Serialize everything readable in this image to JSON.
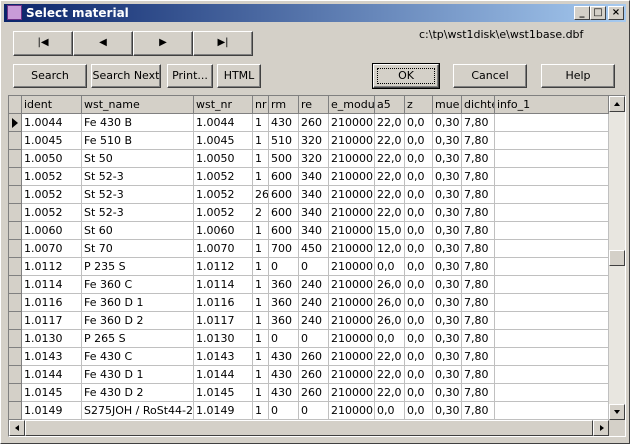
{
  "window": {
    "title": "Select material",
    "minimize": "_",
    "maximize": "□",
    "close": "×"
  },
  "nav": {
    "first": "|◀",
    "prev": "◀",
    "next": "▶",
    "last": "▶|"
  },
  "file_path": "c:\\tp\\wst1disk\\e\\wst1base.dbf",
  "toolbar": {
    "search": "Search",
    "search_next": "Search Next",
    "print": "Print...",
    "html": "HTML",
    "ok": "OK",
    "cancel": "Cancel",
    "help": "Help"
  },
  "table": {
    "columns": [
      "ident",
      "wst_name",
      "wst_nr",
      "nr",
      "rm",
      "re",
      "e_modul",
      "a5",
      "z",
      "mue",
      "dichte",
      "info_1"
    ],
    "rows": [
      [
        "1.0044",
        "Fe 430 B",
        "1.0044",
        "1",
        "430",
        "260",
        "210000",
        "22,0",
        "0,0",
        "0,30",
        "7,80",
        ""
      ],
      [
        "1.0045",
        "Fe 510 B",
        "1.0045",
        "1",
        "510",
        "320",
        "210000",
        "22,0",
        "0,0",
        "0,30",
        "7,80",
        ""
      ],
      [
        "1.0050",
        "St 50",
        "1.0050",
        "1",
        "500",
        "320",
        "210000",
        "22,0",
        "0,0",
        "0,30",
        "7,80",
        ""
      ],
      [
        "1.0052",
        "St 52-3",
        "1.0052",
        "1",
        "600",
        "340",
        "210000",
        "22,0",
        "0,0",
        "0,30",
        "7,80",
        ""
      ],
      [
        "1.0052",
        "St 52-3",
        "1.0052",
        "26",
        "600",
        "340",
        "210000",
        "22,0",
        "0,0",
        "0,30",
        "7,80",
        ""
      ],
      [
        "1.0052",
        "St 52-3",
        "1.0052",
        "2",
        "600",
        "340",
        "210000",
        "22,0",
        "0,0",
        "0,30",
        "7,80",
        ""
      ],
      [
        "1.0060",
        "St 60",
        "1.0060",
        "1",
        "600",
        "340",
        "210000",
        "15,0",
        "0,0",
        "0,30",
        "7,80",
        ""
      ],
      [
        "1.0070",
        "St 70",
        "1.0070",
        "1",
        "700",
        "450",
        "210000",
        "12,0",
        "0,0",
        "0,30",
        "7,80",
        ""
      ],
      [
        "1.0112",
        "P 235 S",
        "1.0112",
        "1",
        "0",
        "0",
        "210000",
        "0,0",
        "0,0",
        "0,30",
        "7,80",
        ""
      ],
      [
        "1.0114",
        "Fe 360 C",
        "1.0114",
        "1",
        "360",
        "240",
        "210000",
        "26,0",
        "0,0",
        "0,30",
        "7,80",
        ""
      ],
      [
        "1.0116",
        "Fe 360 D 1",
        "1.0116",
        "1",
        "360",
        "240",
        "210000",
        "26,0",
        "0,0",
        "0,30",
        "7,80",
        ""
      ],
      [
        "1.0117",
        "Fe 360 D 2",
        "1.0117",
        "1",
        "360",
        "240",
        "210000",
        "26,0",
        "0,0",
        "0,30",
        "7,80",
        ""
      ],
      [
        "1.0130",
        "P 265 S",
        "1.0130",
        "1",
        "0",
        "0",
        "210000",
        "0,0",
        "0,0",
        "0,30",
        "7,80",
        ""
      ],
      [
        "1.0143",
        "Fe 430 C",
        "1.0143",
        "1",
        "430",
        "260",
        "210000",
        "22,0",
        "0,0",
        "0,30",
        "7,80",
        ""
      ],
      [
        "1.0144",
        "Fe 430 D 1",
        "1.0144",
        "1",
        "430",
        "260",
        "210000",
        "22,0",
        "0,0",
        "0,30",
        "7,80",
        ""
      ],
      [
        "1.0145",
        "Fe 430 D 2",
        "1.0145",
        "1",
        "430",
        "260",
        "210000",
        "22,0",
        "0,0",
        "0,30",
        "7,80",
        ""
      ],
      [
        "1.0149",
        "S275JOH / RoSt44-2",
        "1.0149",
        "1",
        "0",
        "0",
        "210000",
        "0,0",
        "0,0",
        "0,30",
        "7,80",
        ""
      ]
    ]
  }
}
